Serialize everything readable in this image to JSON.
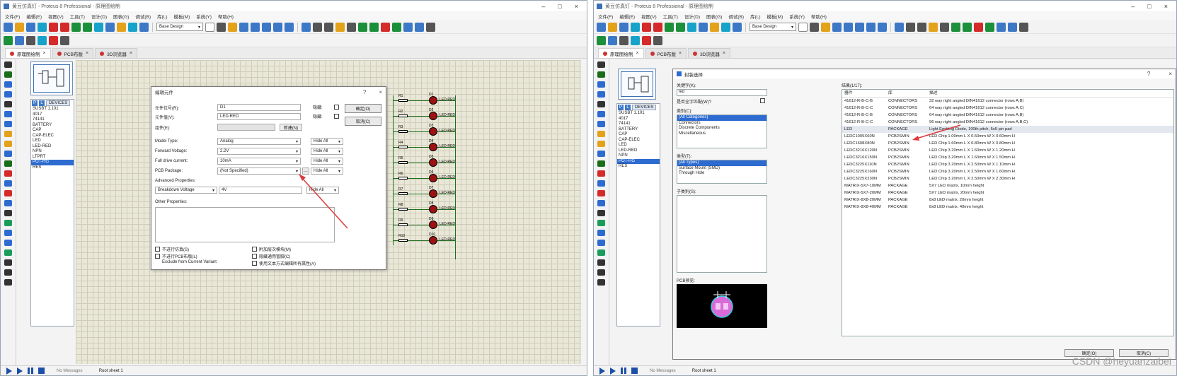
{
  "left": {
    "title": "黄豆仿真灯 - Proteus 8 Professional - 原理图绘制",
    "menu": [
      "文件(F)",
      "编辑(E)",
      "视图(V)",
      "工具(T)",
      "设计(D)",
      "图表(G)",
      "调试(B)",
      "库(L)",
      "模板(M)",
      "系统(Y)",
      "帮助(H)"
    ],
    "toolbar_select": "Base Design",
    "tabs": [
      {
        "label": "原理图绘制",
        "active": true
      },
      {
        "label": "PCB布版",
        "active": false
      },
      {
        "label": "3D浏览器",
        "active": false
      }
    ],
    "devices_label": "DEVICES",
    "devices": [
      "SUSBT 1.101",
      "4017",
      "74141",
      "BATTERY",
      "CAP",
      "CAP-ELEC",
      "LED",
      "LED-RED",
      "NPN",
      "LTPRT",
      "POT-HG",
      "RES"
    ],
    "devices_selected": 10,
    "dialog": {
      "title": "编辑元件",
      "ref_label": "元件位号(R):",
      "ref_value": "D1",
      "value_label": "元件值(V):",
      "value_value": "LED-RED",
      "group_label": "组件(E):",
      "new_btn": "新建(N)",
      "hidden_label": "隐藏:",
      "ok_btn": "确定(O)",
      "cancel_btn": "取消(C)",
      "props": [
        {
          "label": "Model Type:",
          "value": "Analog",
          "hide": "Hide All"
        },
        {
          "label": "Forward Voltage:",
          "value": "2.2V",
          "hide": "Hide All"
        },
        {
          "label": "Full drive current:",
          "value": "10mA",
          "hide": "Hide All"
        },
        {
          "label": "PCB Package:",
          "value": "(Not Specified)",
          "hide": "Hide All"
        }
      ],
      "advanced_label": "Advanced Properties:",
      "advanced_prop": "Breakdown Voltage",
      "advanced_value": "4V",
      "advanced_hide": "Hide All",
      "other_label": "Other Properties:",
      "checks": [
        "不进行仿真(S)",
        "不进行PCB布版(L)",
        "Exclude from Current Variant",
        "附加层次模块(M)",
        "隐藏通用管脚(C)",
        "使用文本方式编辑所有属性(A)"
      ]
    },
    "schematic": {
      "resistor_labels": [
        "R1",
        "R2",
        "R3",
        "R4",
        "R5",
        "R6",
        "R7",
        "R8",
        "R9",
        "R10"
      ],
      "led_labels": [
        "D1",
        "D2",
        "D3",
        "D4",
        "D5",
        "D6",
        "D7",
        "D8",
        "D9",
        "D10"
      ],
      "led_value": "LED-RED"
    },
    "status": "No Messages",
    "sheet": "Root sheet 1"
  },
  "right": {
    "title": "黄豆仿真灯 - Proteus 8 Professional - 原理图绘制",
    "menu": [
      "文件(F)",
      "编辑(E)",
      "视图(V)",
      "工具(T)",
      "设计(D)",
      "图表(G)",
      "调试(B)",
      "库(L)",
      "模板(M)",
      "系统(Y)",
      "帮助(H)"
    ],
    "toolbar_select": "Base Design",
    "tabs": [
      {
        "label": "原理图绘制",
        "active": true
      },
      {
        "label": "PCB布版",
        "active": false
      },
      {
        "label": "3D浏览器",
        "active": false
      }
    ],
    "devices_label": "DEVICES",
    "devices": [
      "SUSBT 1.101",
      "4017",
      "74141",
      "BATTERY",
      "CAP",
      "CAP-ELEC",
      "LED",
      "LED-RED",
      "NPN",
      "POT-HG",
      "RES"
    ],
    "devices_selected": 9,
    "pick": {
      "title": "封装选择",
      "keywords_label": "关键字(K):",
      "keywords_value": "led",
      "match_whole": "是否全字匹配(W)?",
      "category_label": "类别(C):",
      "categories": [
        "(All Categories)",
        "Connectors",
        "Discrete Components",
        "Miscellaneous"
      ],
      "type_label": "类型(T):",
      "types": [
        "(All Types)",
        "Surface Mount (SMD)",
        "Through Hole"
      ],
      "subcat_label": "子类别(S):",
      "pcb_label": "PCB预览:",
      "results_label": "结果(1/17):",
      "headers": [
        "器件",
        "库",
        "描述"
      ],
      "rows": [
        {
          "device": "41612-R-B-C-B",
          "lib": "CONNECTORS",
          "desc": "32 way right angled DIN41612 connector (rows A,B)"
        },
        {
          "device": "41612-R-B-C-C",
          "lib": "CONNECTORS",
          "desc": "64 way right angled DIN41612 connector (rows A,C)"
        },
        {
          "device": "41612-R-B-C-B",
          "lib": "CONNECTORS",
          "desc": "64 way right angled DIN41612 connector (rows A,B)"
        },
        {
          "device": "41612-R-B-C-C",
          "lib": "CONNECTORS",
          "desc": "96 way right angled DIN41612 connector (rows A,B,C)"
        },
        {
          "device": "LED",
          "lib": "PACKAGE",
          "desc": "Light Emitting Diode, 100th pitch, 5x5 pin pad"
        },
        {
          "device": "LEDC1005X60N",
          "lib": "PCB2SMIN",
          "desc": "LED Chip 1.00mm L X 0.50mm W X 0.60mm H"
        },
        {
          "device": "LEDC1608X80N",
          "lib": "PCB2SMIN",
          "desc": "LED Chip 1.60mm L X 0.80mm W X 0.80mm H"
        },
        {
          "device": "LEDC3216X120N",
          "lib": "PCB2SMIN",
          "desc": "LED Chip 3.20mm L X 1.60mm W X 1.20mm H"
        },
        {
          "device": "LEDC3216X150N",
          "lib": "PCB2SMIN",
          "desc": "LED Chip 3.20mm L X 1.60mm W X 1.50mm H"
        },
        {
          "device": "LEDC3225X110N",
          "lib": "PCB2SMIN",
          "desc": "LED Chip 3.20mm L X 2.50mm W X 1.10mm H"
        },
        {
          "device": "LEDC3225X160N",
          "lib": "PCB2SMIN",
          "desc": "LED Chip 3.20mm L X 2.50mm W X 1.60mm H"
        },
        {
          "device": "LEDC3225X230N",
          "lib": "PCB2SMIN",
          "desc": "LED Chip 3.20mm L X 2.50mm W X 2.30mm H"
        },
        {
          "device": "MATRIX-5X7-10MM",
          "lib": "PACKAGE",
          "desc": "5X7 LED matrix, 10mm height"
        },
        {
          "device": "MATRIX-5X7-20MM",
          "lib": "PACKAGE",
          "desc": "5X7 LED matrix, 20mm height"
        },
        {
          "device": "MATRIX-8X8-20MM",
          "lib": "PACKAGE",
          "desc": "8x8 LED matrix, 20mm height"
        },
        {
          "device": "MATRIX-8X8-40MM",
          "lib": "PACKAGE",
          "desc": "8x8 LED matrix, 40mm height"
        }
      ],
      "highlight_row": 4,
      "ok_btn": "确定(O)",
      "cancel_btn": "取消(C)"
    },
    "status": "No Messages",
    "sheet": "Root sheet 1"
  },
  "watermark": "CSDN @heyuanzaibei",
  "colors": {
    "accent": "#2d6bd1",
    "arrow": "#e0393a",
    "led": "#9c1212",
    "wire": "#1a6e1a",
    "pcb_bg": "#000000",
    "pcb_pad": "#d86bd8",
    "pcb_outline": "#2fd0e0"
  }
}
